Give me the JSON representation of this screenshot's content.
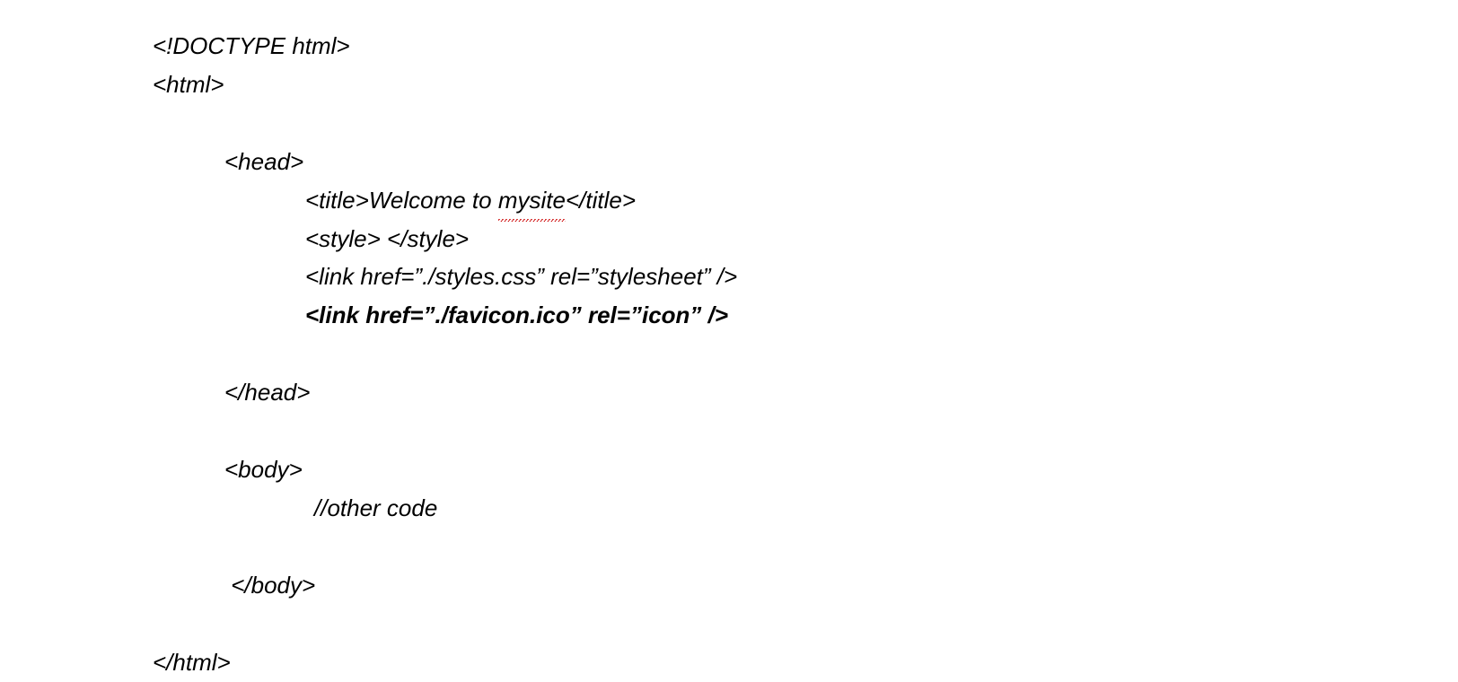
{
  "code": {
    "line1": "<!DOCTYPE html>",
    "line2": "<html>",
    "line3_open": "<head>",
    "line4_pre": "<title>Welcome to ",
    "line4_word": "mysite",
    "line4_post": "</title>",
    "line5": "<style> </style>",
    "line6": "<link href=”./styles.css” rel=”stylesheet” />",
    "line7": "<link href=”./favicon.ico” rel=”icon” />",
    "line8_close": "</head>",
    "line9_open": "<body>",
    "line10": "//other code",
    "line11_close": " </body>",
    "line12": "</html>"
  }
}
